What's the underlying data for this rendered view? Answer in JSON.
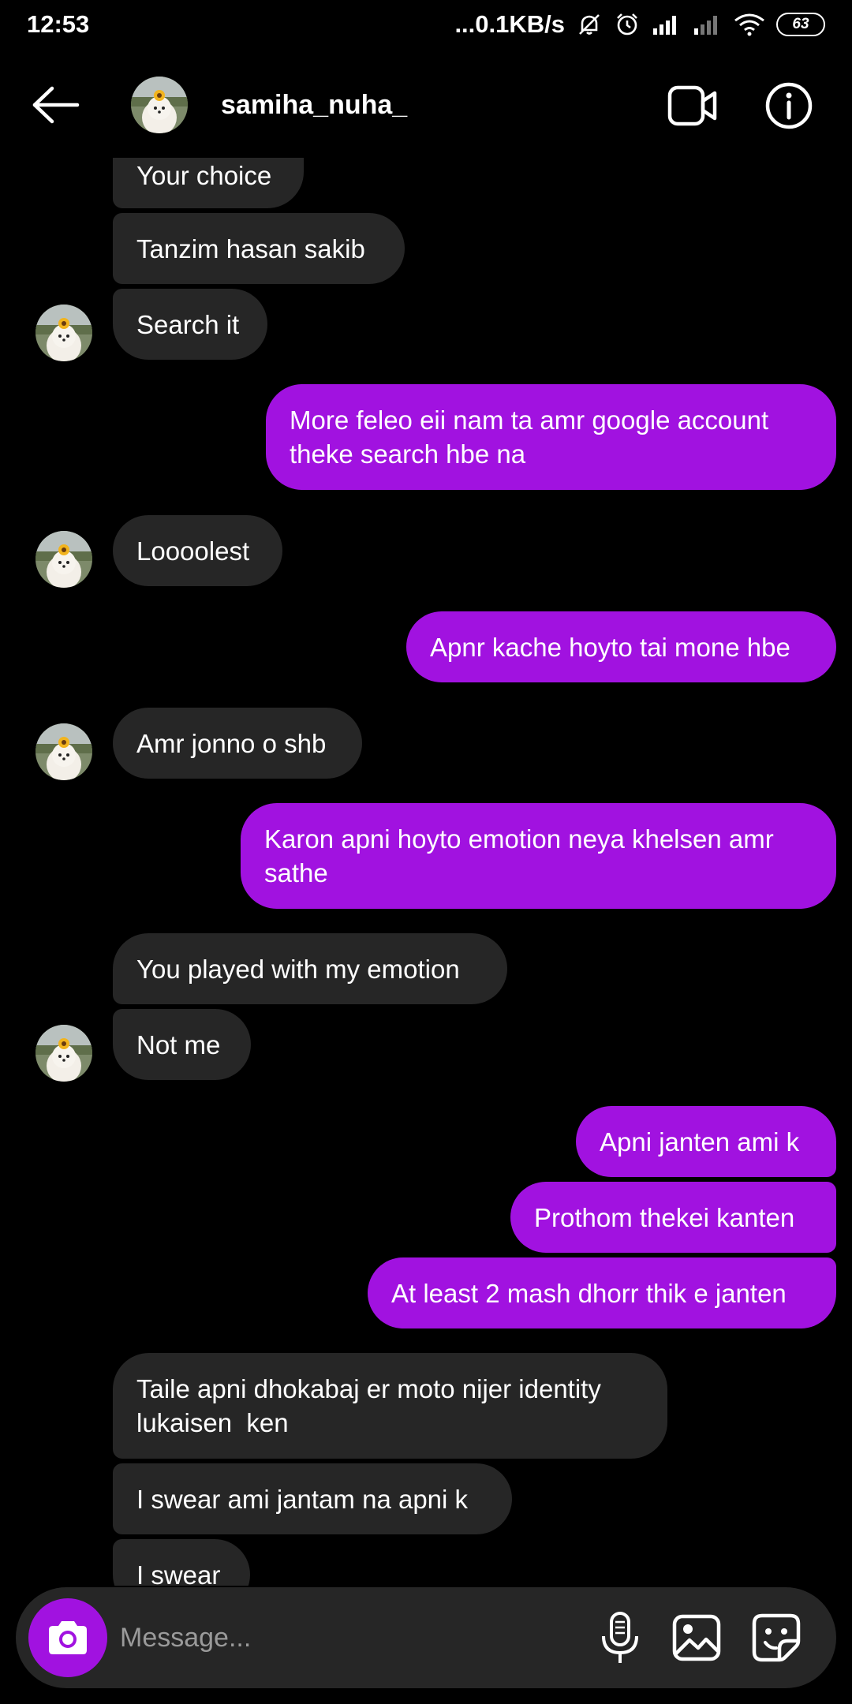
{
  "status_bar": {
    "time": "12:53",
    "network_speed": "...0.1KB/s",
    "battery": "63",
    "icons": [
      "mute-icon",
      "alarm-icon",
      "signal-icon",
      "signal-weak-icon",
      "wifi-icon",
      "battery-icon"
    ]
  },
  "header": {
    "username": "samiha_nuha_",
    "back_icon": "arrow-left-icon",
    "video_icon": "video-camera-icon",
    "info_icon": "info-icon"
  },
  "messages": [
    {
      "from": "them",
      "text": "Your choice"
    },
    {
      "from": "them",
      "text": "Tanzim hasan sakib"
    },
    {
      "from": "them",
      "text": "Search it"
    },
    {
      "from": "me",
      "text": "More feleo eii nam ta amr google account theke search hbe na"
    },
    {
      "from": "them",
      "text": "Loooolest"
    },
    {
      "from": "me",
      "text": "Apnr kache hoyto tai mone hbe"
    },
    {
      "from": "them",
      "text": "Amr jonno o shb"
    },
    {
      "from": "me",
      "text": "Karon apni hoyto emotion neya khelsen amr sathe"
    },
    {
      "from": "them",
      "text": "You played with my emotion"
    },
    {
      "from": "them",
      "text": "Not me"
    },
    {
      "from": "me",
      "text": "Apni janten ami k"
    },
    {
      "from": "me",
      "text": "Prothom thekei kanten"
    },
    {
      "from": "me",
      "text": "At least 2 mash dhorr thik e janten"
    },
    {
      "from": "them",
      "text": "Taile apni dhokabaj er moto nijer identity lukaisen  ken"
    },
    {
      "from": "them",
      "text": "I swear ami jantam na apni k"
    },
    {
      "from": "them",
      "text": "I swear"
    }
  ],
  "composer": {
    "placeholder": "Message...",
    "camera_icon": "camera-icon",
    "mic_icon": "microphone-icon",
    "gallery_icon": "image-icon",
    "sticker_icon": "sticker-icon"
  },
  "colors": {
    "background": "#000000",
    "received_bubble": "#262626",
    "sent_bubble": "#a112e0",
    "text": "#ffffff"
  }
}
